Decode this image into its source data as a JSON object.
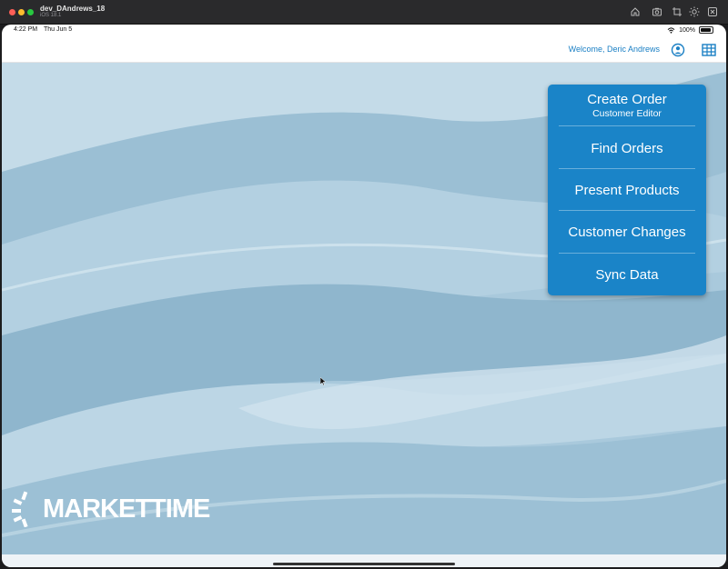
{
  "window": {
    "title": "dev_DAndrews_18",
    "subtitle": "iOS 18.1",
    "toolbar_icons": [
      "home-icon",
      "screenshot-icon",
      "rotate-icon",
      "brightness-icon",
      "close-square-icon"
    ]
  },
  "status_bar": {
    "time": "4:22 PM",
    "date": "Thu Jun 5",
    "battery": "100%"
  },
  "header": {
    "welcome": "Welcome, Deric Andrews",
    "icons": [
      "user-circle-icon",
      "grid-menu-icon"
    ]
  },
  "menu": {
    "create_order": "Create Order",
    "create_order_sub": "Customer Editor",
    "find_orders": "Find Orders",
    "present_products": "Present Products",
    "customer_changes": "Customer Changes",
    "sync_data": "Sync Data"
  },
  "logo": {
    "text": "MARKETTIME"
  },
  "colors": {
    "accent": "#1a84c8",
    "link": "#1a7fc4",
    "wallpaper": "#a8c8db"
  }
}
